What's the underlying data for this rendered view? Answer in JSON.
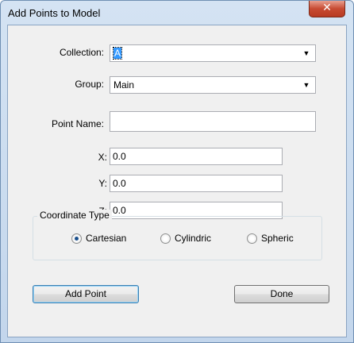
{
  "window": {
    "title": "Add Points to Model",
    "close_glyph": "✕"
  },
  "form": {
    "collection": {
      "label": "Collection:",
      "value": "A"
    },
    "group": {
      "label": "Group:",
      "value": "Main"
    },
    "point_name": {
      "label": "Point Name:",
      "value": ""
    },
    "x": {
      "label": "X:",
      "value": "0.0"
    },
    "y": {
      "label": "Y:",
      "value": "0.0"
    },
    "z": {
      "label": "Z:",
      "value": "0.0"
    }
  },
  "coordinate_type": {
    "legend": "Coordinate Type",
    "options": [
      {
        "label": "Cartesian",
        "checked": true
      },
      {
        "label": "Cylindric",
        "checked": false
      },
      {
        "label": "Spheric",
        "checked": false
      }
    ]
  },
  "buttons": {
    "add_point": "Add Point",
    "done": "Done"
  },
  "icons": {
    "dropdown_arrow": "chevron-down-icon",
    "close": "close-icon"
  }
}
